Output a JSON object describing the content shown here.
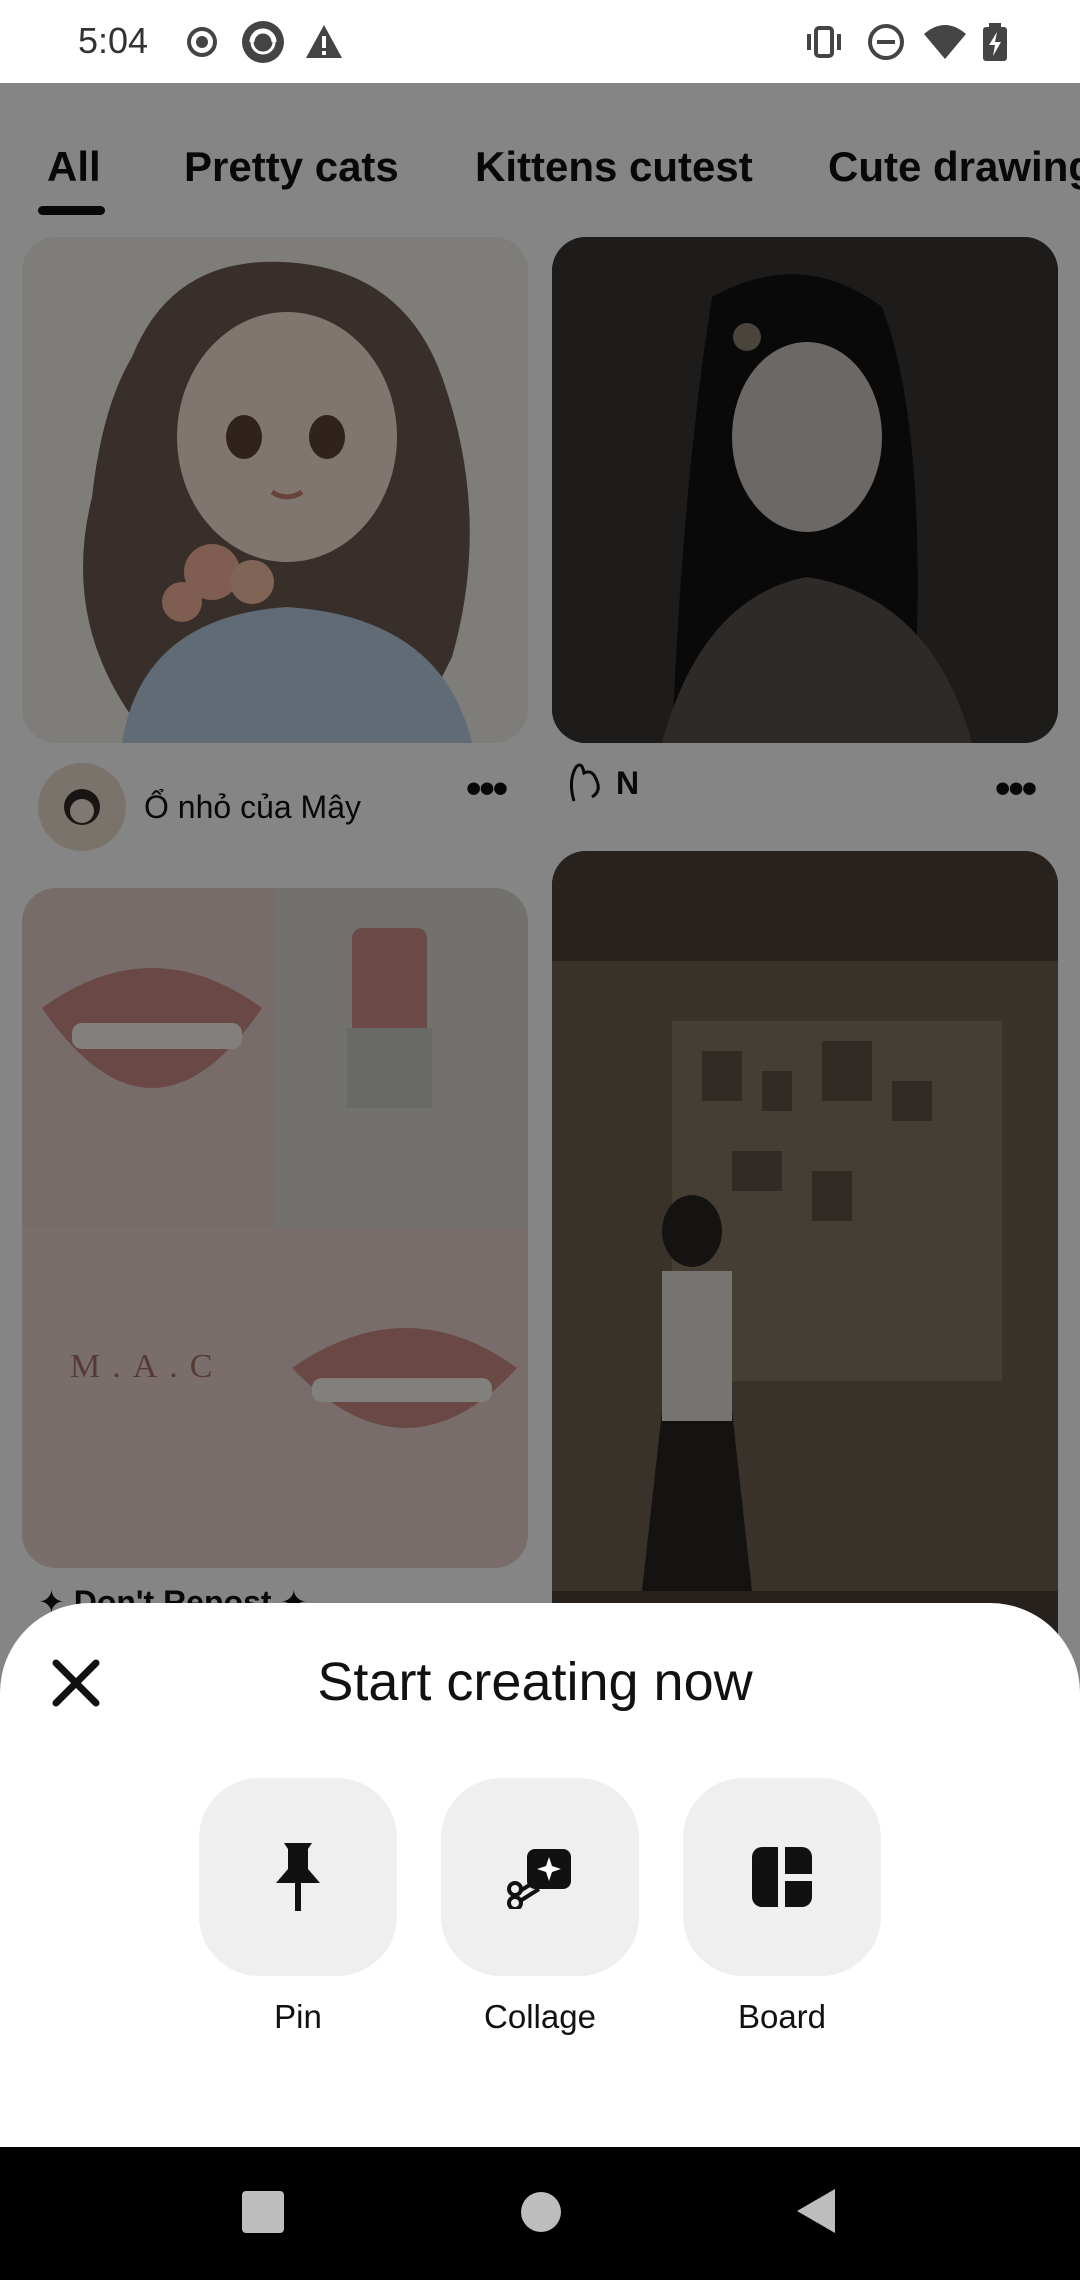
{
  "status_bar": {
    "time": "5:04",
    "left_icons": [
      "record-icon",
      "app-icon",
      "warning-icon"
    ],
    "right_icons": [
      "vibrate-icon",
      "do-not-disturb-icon",
      "wifi-icon",
      "battery-charging-icon"
    ]
  },
  "tabs": [
    {
      "label": "All",
      "selected": true
    },
    {
      "label": "Pretty cats",
      "selected": false
    },
    {
      "label": "Kittens cutest",
      "selected": false
    },
    {
      "label": "Cute drawings",
      "selected": false
    }
  ],
  "feed": {
    "pins": [
      {
        "author": "Ổ nhỏ của Mây",
        "image": "anime girl holding flowers"
      },
      {
        "author": "N",
        "image": "anime girl dark scene"
      },
      {
        "author": "✦ Don't Repost ✦",
        "image": "lipstick collage",
        "overlay_text": "M.A.C"
      },
      {
        "author": "",
        "image": "girl in cluttered studio"
      }
    ]
  },
  "sheet": {
    "title": "Start creating now",
    "close_icon": "close-icon",
    "actions": [
      {
        "label": "Pin",
        "icon": "pin-icon"
      },
      {
        "label": "Collage",
        "icon": "collage-icon"
      },
      {
        "label": "Board",
        "icon": "board-icon"
      }
    ]
  },
  "nav_bar": {
    "buttons": [
      "recents-button",
      "home-button",
      "back-button"
    ]
  }
}
